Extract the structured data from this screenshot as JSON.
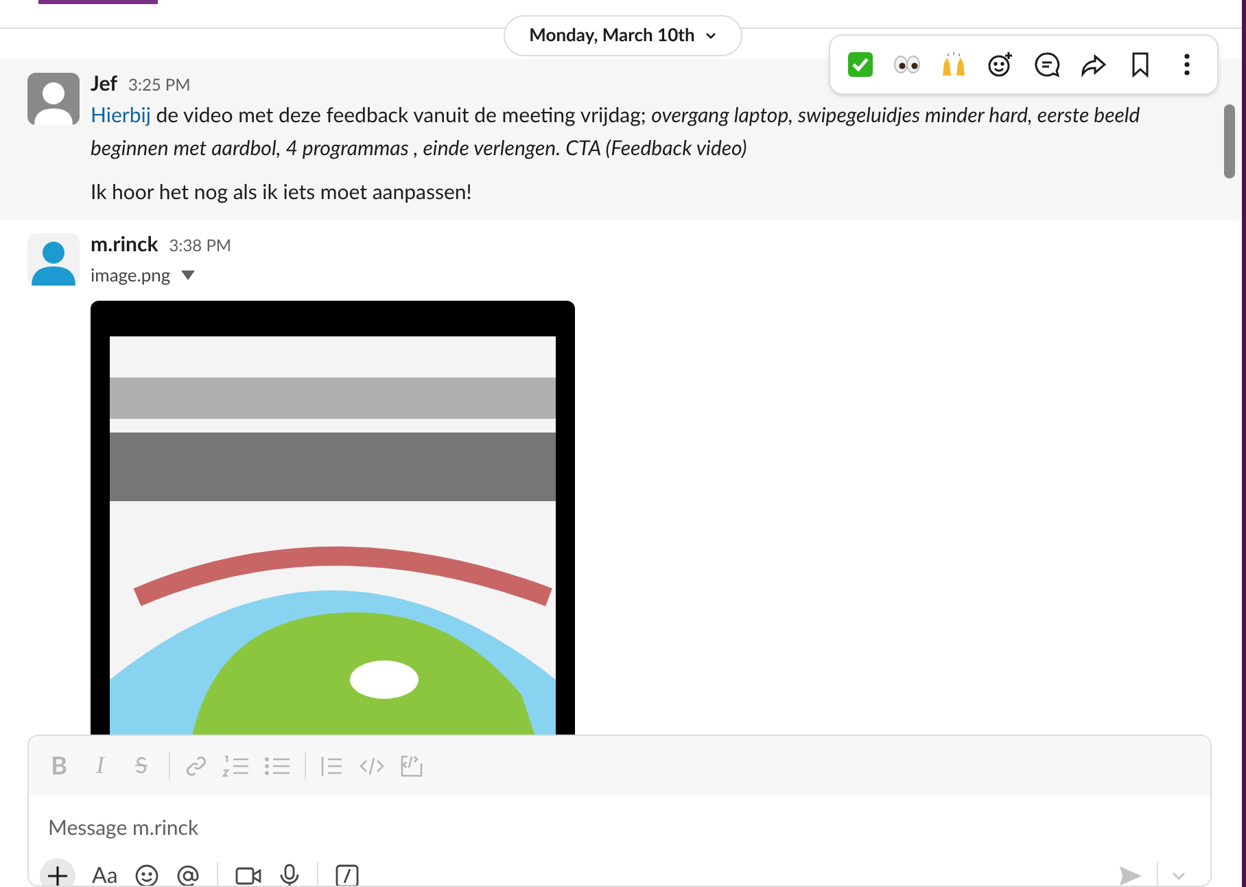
{
  "date_divider": {
    "label": "Monday, March 10th"
  },
  "hover_actions": [
    {
      "kind": "check"
    },
    {
      "kind": "eyes"
    },
    {
      "kind": "hands"
    },
    {
      "kind": "react"
    },
    {
      "kind": "thread"
    },
    {
      "kind": "forward"
    },
    {
      "kind": "bookmark"
    },
    {
      "kind": "more"
    }
  ],
  "messages": [
    {
      "author": "Jef",
      "time": "3:25 PM",
      "kind": "generic",
      "hovered": true,
      "paragraphs": [
        {
          "link": "Hierbij",
          "text": " de video met deze feedback vanuit de meeting vrijdag; *overgang laptop, swipegeluidjes minder hard, eerste beeld beginnen met aardbol, 4 programmas , einde verlengen. CTA (Feedback video)*"
        },
        {
          "text": "Ik hoor het nog als ik iets moet aanpassen!"
        }
      ]
    },
    {
      "author": "m.rinck",
      "time": "3:38 PM",
      "kind": "silhouette",
      "hovered": false,
      "attachment": {
        "filename": "image.png"
      }
    }
  ],
  "composer": {
    "placeholder": "Message m.rinck",
    "format_tools": [
      {
        "kind": "bold",
        "label": "B"
      },
      {
        "kind": "italic",
        "label": "I"
      },
      {
        "kind": "strike",
        "label": "S"
      },
      {
        "kind": "sep"
      },
      {
        "kind": "link"
      },
      {
        "kind": "ol"
      },
      {
        "kind": "ul"
      },
      {
        "kind": "sep"
      },
      {
        "kind": "quote"
      },
      {
        "kind": "code"
      },
      {
        "kind": "codeblock"
      }
    ],
    "bottom_tools": [
      {
        "kind": "plus"
      },
      {
        "kind": "text",
        "label": "Aa"
      },
      {
        "kind": "emoji"
      },
      {
        "kind": "mention"
      },
      {
        "kind": "sep"
      },
      {
        "kind": "video"
      },
      {
        "kind": "mic"
      },
      {
        "kind": "sep"
      },
      {
        "kind": "slash"
      }
    ]
  }
}
